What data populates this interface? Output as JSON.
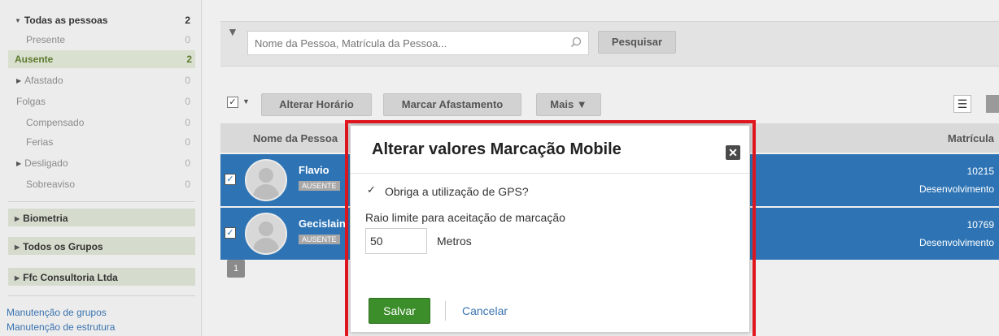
{
  "sidebar": {
    "items": [
      {
        "label": "Todas as pessoas",
        "count": "2"
      },
      {
        "label": "Presente",
        "count": "0"
      },
      {
        "label": "Ausente",
        "count": "2"
      },
      {
        "label": "Afastado",
        "count": "0"
      },
      {
        "label": "Folgas",
        "count": "0"
      },
      {
        "label": "Compensado",
        "count": "0"
      },
      {
        "label": "Ferias",
        "count": "0"
      },
      {
        "label": "Desligado",
        "count": "0"
      },
      {
        "label": "Sobreaviso",
        "count": "0"
      }
    ],
    "groups": [
      "Biometria",
      "Todos os Grupos",
      "Ffc Consultoria Ltda"
    ],
    "links": [
      "Manutenção de grupos",
      "Manutenção de estrutura"
    ]
  },
  "search": {
    "placeholder": "Nome da Pessoa, Matrícula da Pessoa...",
    "button": "Pesquisar"
  },
  "toolbar": {
    "alterar_horario": "Alterar Horário",
    "marcar_afastamento": "Marcar Afastamento",
    "mais": "Mais ▼"
  },
  "table": {
    "col_nome": "Nome da Pessoa",
    "col_matricula": "Matrícula",
    "rows": [
      {
        "name": "Flavio",
        "status": "AUSENTE",
        "matricula": "10215",
        "departamento": "Desenvolvimento",
        "checked": true
      },
      {
        "name": "Gecislain",
        "status": "AUSENTE",
        "matricula": "10769",
        "departamento": "Desenvolvimento",
        "checked": true
      }
    ]
  },
  "pagination": {
    "current": "1"
  },
  "modal": {
    "title": "Alterar valores Marcação Mobile",
    "gps_label": "Obriga a utilização de GPS?",
    "gps_checked": true,
    "raio_label": "Raio limite para aceitação de marcação",
    "raio_value": "50",
    "raio_unit": "Metros",
    "save": "Salvar",
    "cancel": "Cancelar"
  },
  "colors": {
    "selected_row": "#2e74b5",
    "save_button": "#3c8e2b",
    "highlight_frame": "#e3171f"
  }
}
